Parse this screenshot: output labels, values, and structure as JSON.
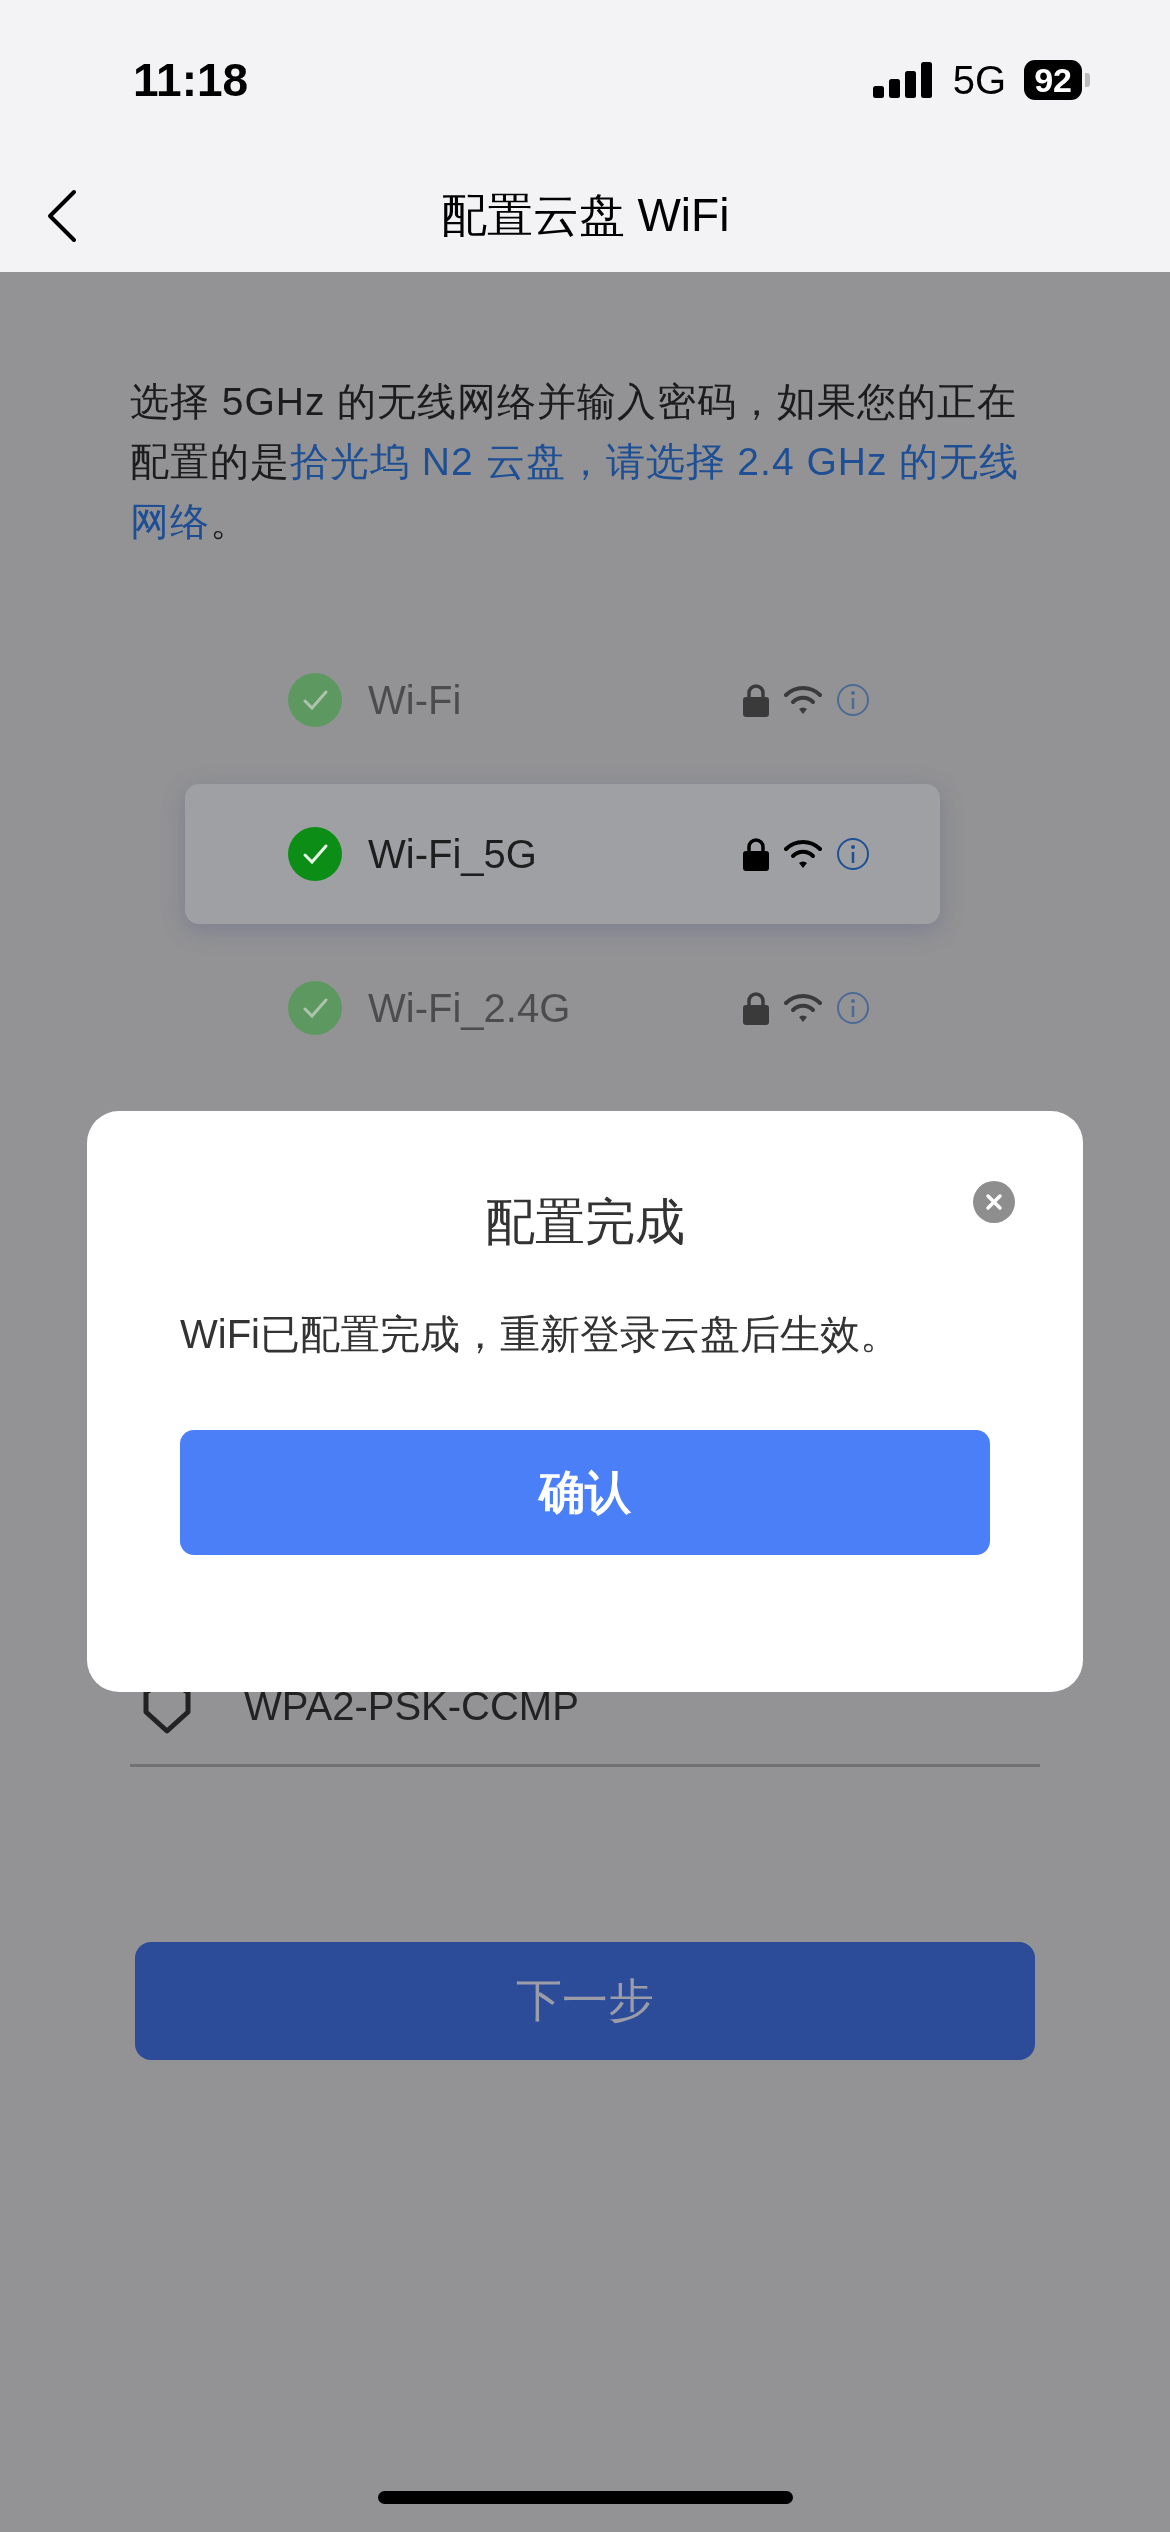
{
  "status_bar": {
    "time": "11:18",
    "network": "5G",
    "battery": "92"
  },
  "header": {
    "title": "配置云盘 WiFi"
  },
  "instruction": [
    {
      "kind": "plain",
      "text": "选择 5GHz 的无线网络并输入密码，如果您的正在配置的是"
    },
    {
      "kind": "highlight",
      "text": "拾光坞 N2 云盘，请选择 2.4 GHz 的无线网络"
    },
    {
      "kind": "plain",
      "text": "。"
    }
  ],
  "networks": [
    {
      "name": "Wi-Fi",
      "selected": false
    },
    {
      "name": "Wi-Fi_5G",
      "selected": true
    },
    {
      "name": "Wi-Fi_2.4G",
      "selected": false
    }
  ],
  "security": {
    "value": "WPA2-PSK-CCMP"
  },
  "next_button": {
    "label": "下一步"
  },
  "dialog": {
    "title": "配置完成",
    "message": "WiFi已配置完成，重新登录云盘后生效。",
    "confirm": "确认"
  }
}
